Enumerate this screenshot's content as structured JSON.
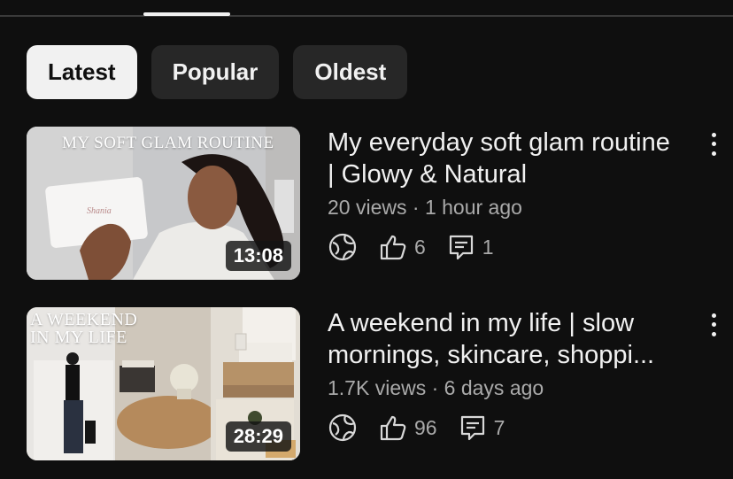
{
  "filters": [
    {
      "label": "Latest",
      "active": true
    },
    {
      "label": "Popular",
      "active": false
    },
    {
      "label": "Oldest",
      "active": false
    }
  ],
  "videos": [
    {
      "thumbnail_text": "MY SOFT GLAM ROUTINE",
      "box_logo_text": "Shania",
      "duration": "13:08",
      "title": "My everyday soft glam routine | Glowy & Natural",
      "views": "20 views",
      "age": "1 hour ago",
      "likes": "6",
      "comments": "1",
      "icons": {
        "visibility": "globe-icon",
        "likes": "thumbs-up-icon",
        "comments": "comment-icon",
        "menu": "more-vert-icon"
      }
    },
    {
      "thumbnail_text_line1": "A WEEKEND",
      "thumbnail_text_line2": "IN MY LIFE",
      "duration": "28:29",
      "title": "A weekend in my life | slow mornings, skincare, shoppi...",
      "views": "1.7K views",
      "age": "6 days ago",
      "likes": "96",
      "comments": "7",
      "icons": {
        "visibility": "globe-icon",
        "likes": "thumbs-up-icon",
        "comments": "comment-icon",
        "menu": "more-vert-icon"
      }
    }
  ],
  "colors": {
    "background": "#0f0f0f",
    "chip_active": "#f1f1f1",
    "chip": "#272727",
    "text_secondary": "#aaaaaa"
  }
}
